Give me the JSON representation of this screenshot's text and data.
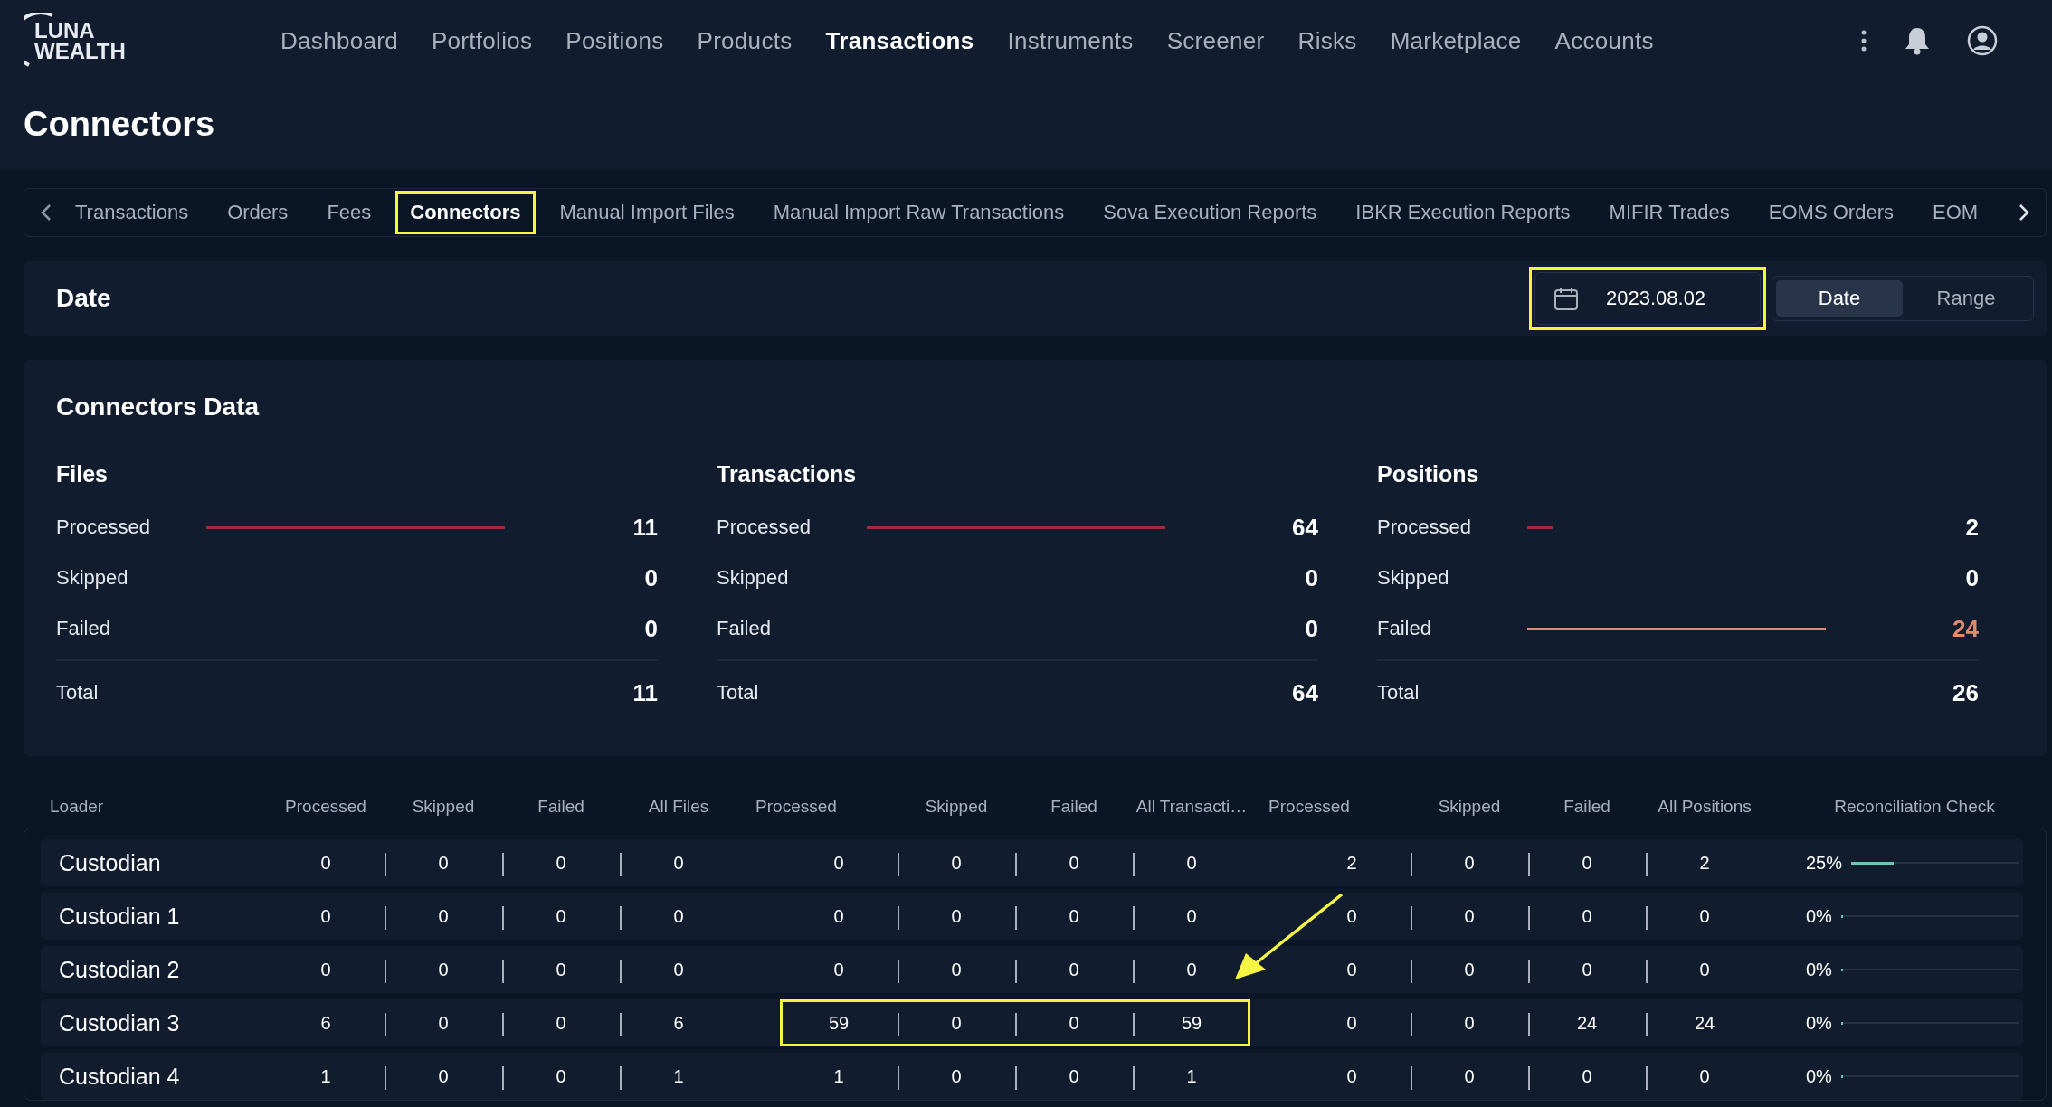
{
  "logo": {
    "line1": "LUNA",
    "line2": "WEALTH"
  },
  "nav": [
    {
      "label": "Dashboard",
      "selected": false
    },
    {
      "label": "Portfolios",
      "selected": false
    },
    {
      "label": "Positions",
      "selected": false
    },
    {
      "label": "Products",
      "selected": false
    },
    {
      "label": "Transactions",
      "selected": true
    },
    {
      "label": "Instruments",
      "selected": false
    },
    {
      "label": "Screener",
      "selected": false
    },
    {
      "label": "Risks",
      "selected": false
    },
    {
      "label": "Marketplace",
      "selected": false
    },
    {
      "label": "Accounts",
      "selected": false
    }
  ],
  "page_title": "Connectors",
  "subtabs": [
    {
      "label": "Transactions",
      "selected": false,
      "highlighted": false
    },
    {
      "label": "Orders",
      "selected": false,
      "highlighted": false
    },
    {
      "label": "Fees",
      "selected": false,
      "highlighted": false
    },
    {
      "label": "Connectors",
      "selected": true,
      "highlighted": true
    },
    {
      "label": "Manual Import Files",
      "selected": false,
      "highlighted": false
    },
    {
      "label": "Manual Import Raw Transactions",
      "selected": false,
      "highlighted": false
    },
    {
      "label": "Sova Execution Reports",
      "selected": false,
      "highlighted": false
    },
    {
      "label": "IBKR Execution Reports",
      "selected": false,
      "highlighted": false
    },
    {
      "label": "MIFIR Trades",
      "selected": false,
      "highlighted": false
    },
    {
      "label": "EOMS Orders",
      "selected": false,
      "highlighted": false
    },
    {
      "label": "EOM",
      "selected": false,
      "highlighted": false
    }
  ],
  "date_card": {
    "title": "Date",
    "date_value": "2023.08.02",
    "date_highlighted": true,
    "modes": [
      {
        "label": "Date",
        "selected": true
      },
      {
        "label": "Range",
        "selected": false
      }
    ]
  },
  "connectors_data": {
    "title": "Connectors Data",
    "groups": [
      {
        "title": "Files",
        "rows": [
          {
            "label": "Processed",
            "value": "11",
            "color": "#9b2c38",
            "alert": false
          },
          {
            "label": "Skipped",
            "value": "0",
            "alert": false
          },
          {
            "label": "Failed",
            "value": "0",
            "alert": false
          }
        ],
        "total_label": "Total",
        "total": "11"
      },
      {
        "title": "Transactions",
        "rows": [
          {
            "label": "Processed",
            "value": "64",
            "color": "#9b2c38",
            "alert": false
          },
          {
            "label": "Skipped",
            "value": "0",
            "alert": false
          },
          {
            "label": "Failed",
            "value": "0",
            "alert": false
          }
        ],
        "total_label": "Total",
        "total": "64"
      },
      {
        "title": "Positions",
        "rows": [
          {
            "label": "Processed",
            "value": "2",
            "color": "#9b2c38",
            "alert": false
          },
          {
            "label": "Skipped",
            "value": "0",
            "alert": false
          },
          {
            "label": "Failed",
            "value": "24",
            "color": "#e08a6e",
            "alert": true
          }
        ],
        "total_label": "Total",
        "total": "26"
      }
    ]
  },
  "table": {
    "columns": [
      "Loader",
      "Processed",
      "Skipped",
      "Failed",
      "All Files",
      "Processed",
      "Skipped",
      "Failed",
      "All Transacti…",
      "Processed",
      "Skipped",
      "Failed",
      "All Positions",
      "Reconciliation Check"
    ],
    "rows": [
      {
        "loader": "Custodian",
        "files": {
          "values": [
            "0",
            "0",
            "0",
            "0"
          ],
          "highlighted": false
        },
        "transactions": {
          "values": [
            "0",
            "0",
            "0",
            "0"
          ],
          "highlighted": false
        },
        "positions": {
          "values": [
            "2",
            "0",
            "0",
            "2"
          ],
          "highlighted": false
        },
        "reconciliation": "25%",
        "level": 0.25
      },
      {
        "loader": "Custodian 1",
        "files": {
          "values": [
            "0",
            "0",
            "0",
            "0"
          ],
          "highlighted": false
        },
        "transactions": {
          "values": [
            "0",
            "0",
            "0",
            "0"
          ],
          "highlighted": false
        },
        "positions": {
          "values": [
            "0",
            "0",
            "0",
            "0"
          ],
          "highlighted": false
        },
        "reconciliation": "0%",
        "level": 0
      },
      {
        "loader": "Custodian 2",
        "files": {
          "values": [
            "0",
            "0",
            "0",
            "0"
          ],
          "highlighted": false
        },
        "transactions": {
          "values": [
            "0",
            "0",
            "0",
            "0"
          ],
          "highlighted": false
        },
        "positions": {
          "values": [
            "0",
            "0",
            "0",
            "0"
          ],
          "highlighted": false
        },
        "reconciliation": "0%",
        "level": 0
      },
      {
        "loader": "Custodian 3",
        "files": {
          "values": [
            "6",
            "0",
            "0",
            "6"
          ],
          "highlighted": false
        },
        "transactions": {
          "values": [
            "59",
            "0",
            "0",
            "59"
          ],
          "highlighted": true
        },
        "positions": {
          "values": [
            "0",
            "0",
            "24",
            "24"
          ],
          "highlighted": false
        },
        "reconciliation": "0%",
        "level": 0
      },
      {
        "loader": "Custodian 4",
        "files": {
          "values": [
            "1",
            "0",
            "0",
            "1"
          ],
          "highlighted": false
        },
        "transactions": {
          "values": [
            "1",
            "0",
            "0",
            "1"
          ],
          "highlighted": false
        },
        "positions": {
          "values": [
            "0",
            "0",
            "0",
            "0"
          ],
          "highlighted": false
        },
        "reconciliation": "0%",
        "level": 0
      }
    ]
  }
}
